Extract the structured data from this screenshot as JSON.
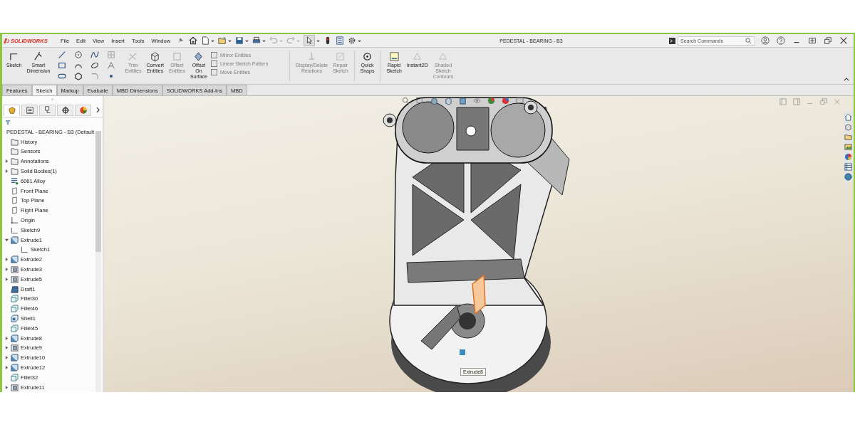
{
  "title_bar": {
    "logo": "SOLIDWORKS",
    "menu": [
      "File",
      "Edit",
      "View",
      "Insert",
      "Tools",
      "Window"
    ],
    "quick_access": [
      {
        "kind": "home",
        "disabled": false
      },
      {
        "kind": "new",
        "disabled": false
      },
      {
        "kind": "open",
        "disabled": false
      },
      {
        "kind": "save",
        "disabled": false
      },
      {
        "kind": "print",
        "disabled": false
      },
      {
        "kind": "undo",
        "disabled": true
      },
      {
        "kind": "redo",
        "disabled": true
      },
      {
        "kind": "select",
        "disabled": false
      },
      {
        "kind": "rebuild",
        "disabled": false
      },
      {
        "kind": "properties",
        "disabled": false
      },
      {
        "kind": "options",
        "disabled": false
      }
    ],
    "document_title": "PEDESTAL - BEARING - B3",
    "search": {
      "placeholder": "Search Commands"
    }
  },
  "ribbon": {
    "tools": [
      {
        "kind": "large",
        "label": "Sketch",
        "disabled": false
      },
      {
        "kind": "large",
        "label": "Smart Dimension",
        "disabled": false
      },
      {
        "kind": "entity_grid"
      },
      {
        "kind": "large",
        "label": "Trim Entities",
        "disabled": true
      },
      {
        "kind": "large",
        "label": "Convert Entities",
        "disabled": false
      },
      {
        "kind": "large",
        "label": "Offset Entities",
        "disabled": true
      },
      {
        "kind": "large",
        "label": "Offset On Surface",
        "disabled": false
      },
      {
        "kind": "stack",
        "items": [
          {
            "label": "Mirror Entities",
            "disabled": true
          },
          {
            "label": "Linear Sketch Pattern",
            "disabled": true
          },
          {
            "label": "Move Entities",
            "disabled": true
          }
        ]
      },
      {
        "kind": "separator"
      },
      {
        "kind": "large",
        "label": "Display/Delete Relations",
        "disabled": true
      },
      {
        "kind": "large",
        "label": "Repair Sketch",
        "disabled": true
      },
      {
        "kind": "separator"
      },
      {
        "kind": "large",
        "label": "Quick Snaps",
        "disabled": false
      },
      {
        "kind": "separator"
      },
      {
        "kind": "large",
        "label": "Rapid Sketch",
        "disabled": false
      },
      {
        "kind": "large",
        "label": "Instant2D",
        "disabled": false
      },
      {
        "kind": "large",
        "label": "Shaded Sketch Contours",
        "disabled": true
      }
    ]
  },
  "command_tabs": [
    {
      "label": "Features",
      "selected": false
    },
    {
      "label": "Sketch",
      "selected": true
    },
    {
      "label": "Markup",
      "selected": false
    },
    {
      "label": "Evaluate",
      "selected": false
    },
    {
      "label": "MBD Dimensions",
      "selected": false
    },
    {
      "label": "SOLIDWORKS Add-Ins",
      "selected": false
    },
    {
      "label": "MBD",
      "selected": false
    }
  ],
  "panel_tabs": [
    {
      "selected": true
    },
    {
      "selected": false
    },
    {
      "selected": false
    },
    {
      "selected": false
    },
    {
      "selected": false
    }
  ],
  "feature_tree": {
    "root": "PEDESTAL - BEARING - B3  (Default",
    "items": [
      {
        "label": "History",
        "kind": "folder"
      },
      {
        "label": "Sensors",
        "kind": "folder"
      },
      {
        "label": "Annotations",
        "kind": "folder",
        "expanded": false
      },
      {
        "label": "Solid Bodies(1)",
        "kind": "folder",
        "expanded": false
      },
      {
        "label": "6061 Alloy",
        "kind": "material"
      },
      {
        "label": "Front Plane",
        "kind": "plane"
      },
      {
        "label": "Top Plane",
        "kind": "plane"
      },
      {
        "label": "Right Plane",
        "kind": "plane"
      },
      {
        "label": "Origin",
        "kind": "origin"
      },
      {
        "label": "Sketch9",
        "kind": "sketch"
      },
      {
        "label": "Extrude1",
        "kind": "boss",
        "expanded": true,
        "children": [
          {
            "label": "Sketch1",
            "kind": "sketch"
          }
        ]
      },
      {
        "label": "Extrude2",
        "kind": "boss",
        "expanded": false
      },
      {
        "label": "Extrude3",
        "kind": "cut",
        "expanded": false
      },
      {
        "label": "Extrude5",
        "kind": "cut",
        "expanded": false
      },
      {
        "label": "Draft1",
        "kind": "draft"
      },
      {
        "label": "Fillet30",
        "kind": "fillet"
      },
      {
        "label": "Fillet46",
        "kind": "fillet"
      },
      {
        "label": "Shell1",
        "kind": "shell"
      },
      {
        "label": "Fillet45",
        "kind": "fillet"
      },
      {
        "label": "Extrude8",
        "kind": "boss",
        "expanded": false
      },
      {
        "label": "Extrude9",
        "kind": "cut",
        "expanded": false
      },
      {
        "label": "Extrude10",
        "kind": "boss",
        "expanded": false
      },
      {
        "label": "Extrude12",
        "kind": "boss",
        "expanded": false
      },
      {
        "label": "Fillet32",
        "kind": "fillet"
      },
      {
        "label": "Extrude11",
        "kind": "cut",
        "expanded": false
      }
    ]
  },
  "viewport": {
    "tooltip": "Extrude8"
  }
}
